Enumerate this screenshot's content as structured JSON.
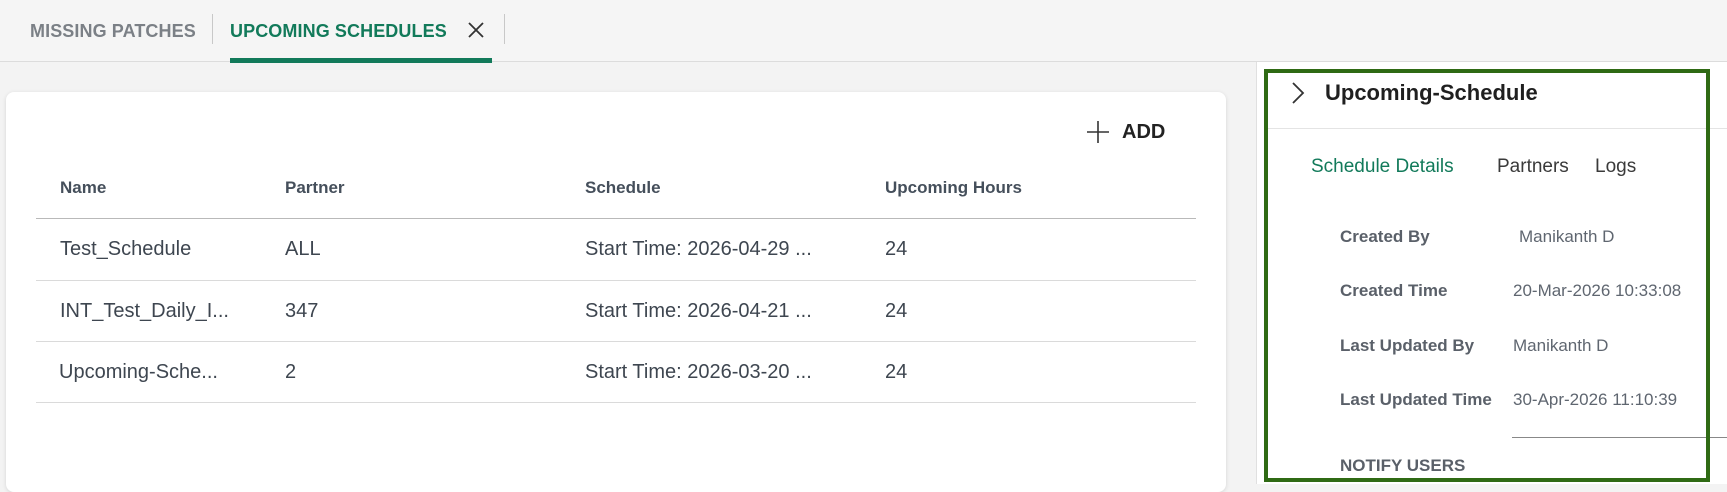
{
  "tabs": {
    "missing": "MISSING PATCHES",
    "upcoming": "UPCOMING SCHEDULES"
  },
  "toolbar": {
    "add_label": "ADD"
  },
  "table": {
    "columns": [
      "Name",
      "Partner",
      "Schedule",
      "Upcoming Hours"
    ],
    "rows": [
      [
        "Test_Schedule",
        "ALL",
        "Start Time: 2026-04-29 ...",
        "24"
      ],
      [
        "INT_Test_Daily_I...",
        "347",
        "Start Time: 2026-04-21 ...",
        "24"
      ],
      [
        "Upcoming-Sche...",
        "2",
        "Start Time: 2026-03-20 ...",
        "24"
      ]
    ]
  },
  "panel": {
    "title": "Upcoming-Schedule",
    "tabs": [
      "Schedule Details",
      "Partners",
      "Logs"
    ],
    "details": [
      {
        "label": "Created By",
        "value": "Manikanth D"
      },
      {
        "label": "Created Time",
        "value": "20-Mar-2026 10:33:08"
      },
      {
        "label": "Last Updated By",
        "value": "Manikanth D"
      },
      {
        "label": "Last Updated Time",
        "value": "30-Apr-2026 11:10:39"
      }
    ],
    "notify_label": "NOTIFY USERS"
  },
  "colors": {
    "accent": "#127a5a",
    "outline": "#2f6a14"
  },
  "icons": [
    "close-icon",
    "plus-icon",
    "chevron-right-icon"
  ]
}
